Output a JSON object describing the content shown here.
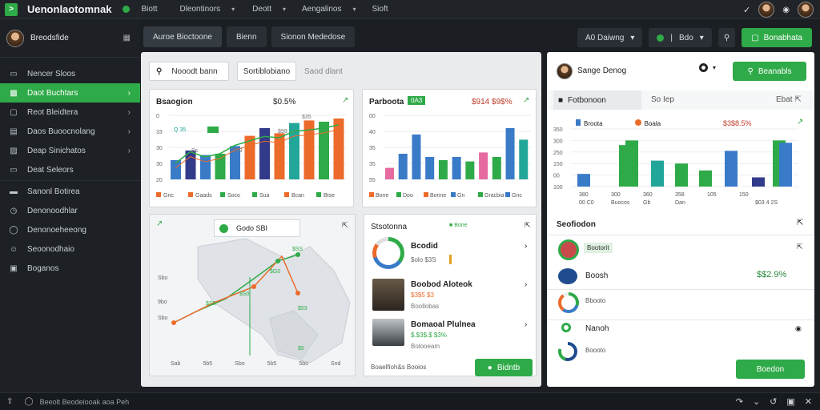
{
  "topbar": {
    "logo_glyph": ">",
    "app_title": "Uenonlaotomnak",
    "nav": [
      "Biott",
      "Dleontinors",
      "Deott",
      "Aengalinos",
      "Sioft"
    ]
  },
  "sidebar": {
    "user_name": "Breodsfide",
    "items": [
      {
        "label": "Nencer Sloos"
      },
      {
        "label": "Daot Buchtars"
      },
      {
        "label": "Reot Bleidtera"
      },
      {
        "label": "Daos Buoocnolang"
      },
      {
        "label": "Deap Sinichatos"
      },
      {
        "label": "Deat Seleors"
      },
      {
        "label": "Sanonl Botirea"
      },
      {
        "label": "Denonoodhlar"
      },
      {
        "label": "Denonoeheeong"
      },
      {
        "label": "Seoonodhaio"
      },
      {
        "label": "Boganos"
      }
    ]
  },
  "tabs": [
    "Auroe Bioctoone",
    "Bienn",
    "Sionon Mededose"
  ],
  "toolbar": {
    "dropdown_label": "A0 Daiwng",
    "status_label": "Bdo",
    "add_button": "Bonabhata"
  },
  "search": {
    "input_value": "Nooodt bann",
    "filter_value": "Sortiblobiano",
    "hint": "Saod dlant"
  },
  "chart1": {
    "title": "Bsaogion",
    "value": "$0.5%",
    "legend": [
      "Gnc",
      "Gaads",
      "Soco",
      "Sua",
      "Bcan",
      "Btse"
    ],
    "inline_a": "Q 35",
    "inline_b": "Bee",
    "points": [
      "Ss",
      "$09",
      "$99",
      "$35"
    ]
  },
  "chart2": {
    "title": "Parboota",
    "badge": "0A3",
    "value": "$914 $9$%",
    "legend": [
      "Bone",
      "Doo",
      "Bonne",
      "Gn",
      "Gracbia",
      "Gnc"
    ]
  },
  "map_card": {
    "title": "Godo SBI",
    "axis_labels": [
      "Sbo",
      "9bo",
      "Sbo"
    ],
    "x_labels": [
      "Sab",
      "5b5",
      "Sbo",
      "5b5",
      "5bo",
      "Snd"
    ],
    "point_labels": [
      "$SS",
      "$G0",
      "$S0",
      "$S5",
      "$53",
      "$5"
    ]
  },
  "list_card": {
    "title": "Stsotonna",
    "tag": "Bone",
    "items": [
      {
        "name": "Bcodid",
        "sub": "$olo $3S"
      },
      {
        "name": "Boobod Aloteok",
        "sub": "$3$5 $3",
        "sub2": "Boollobas"
      },
      {
        "name": "Bomaoal Plulnea",
        "sub": "$.$3$.$ $3%",
        "sub2": "Bolooeam"
      }
    ],
    "footer": "Boaelfioh&s Booios",
    "button": "Bidntb"
  },
  "right": {
    "user_name": "Sange Denog",
    "button": "Beanabls",
    "tab1": "Fotbonoon",
    "tab2": "So Iep",
    "tab3": "Ebat",
    "legend": [
      "Broota",
      "Boala"
    ],
    "value": "$3$8.5%",
    "y_ticks": [
      "350",
      "300",
      "250",
      "150",
      "00",
      "100"
    ],
    "x_ticks": [
      "380",
      "300",
      "360",
      "358",
      "105",
      "150"
    ],
    "x_sub": [
      "00 C0",
      "Buocos",
      "Gb",
      "Dan"
    ],
    "x_tail": "$03 4 2S",
    "section": "Seofiodon",
    "rows": [
      {
        "name": "Bootorit"
      },
      {
        "name": "Boosh",
        "value": "$$2.9%"
      },
      {
        "name": "Bbooto"
      },
      {
        "name": "Nanoh"
      },
      {
        "name": "Boooto"
      }
    ],
    "bottom_button": "Boedon"
  },
  "status_bar": {
    "text": "Beeolt Beodeiooak aoa Peh"
  },
  "chart_data": [
    {
      "type": "bar",
      "title": "Bsaogion",
      "categories": [
        "Gnc",
        "Gaads",
        "Soco",
        "Sua",
        "Bcan",
        "Btse"
      ],
      "y_ticks": [
        "20",
        "30",
        "30",
        "33",
        "0"
      ],
      "ylim": [
        0,
        100
      ],
      "series": [
        {
          "values": [
            30,
            45,
            38,
            40,
            52,
            68,
            80,
            72,
            88,
            92,
            90,
            95
          ]
        },
        {
          "values": [
            20,
            38,
            30,
            35,
            48,
            55,
            62,
            60,
            70,
            72,
            75,
            80
          ]
        }
      ]
    },
    {
      "type": "bar",
      "title": "Parboota",
      "categories": [
        "Bone",
        "Doo",
        "Bonne",
        "Gn",
        "Gracbia",
        "Gnc"
      ],
      "y_ticks": [
        "55",
        "35",
        "35",
        "40",
        "00"
      ],
      "ylim": [
        0,
        100
      ],
      "series": [
        {
          "values": [
            18,
            40,
            70,
            35,
            30,
            35,
            28,
            42,
            35,
            80,
            62
          ]
        }
      ]
    },
    {
      "type": "bar",
      "title": "Fotbonoon",
      "ylim": [
        0,
        100
      ],
      "series": [
        {
          "name": "Broota",
          "values": [
            22,
            72,
            80,
            45,
            40,
            28,
            62,
            16,
            80,
            76
          ]
        }
      ]
    }
  ],
  "colors": {
    "accent": "#2faa48",
    "orange": "#ec6b2a",
    "blue": "#3a7bc8",
    "teal": "#23a69a",
    "navy": "#323a8a",
    "pink": "#e66aa0"
  }
}
